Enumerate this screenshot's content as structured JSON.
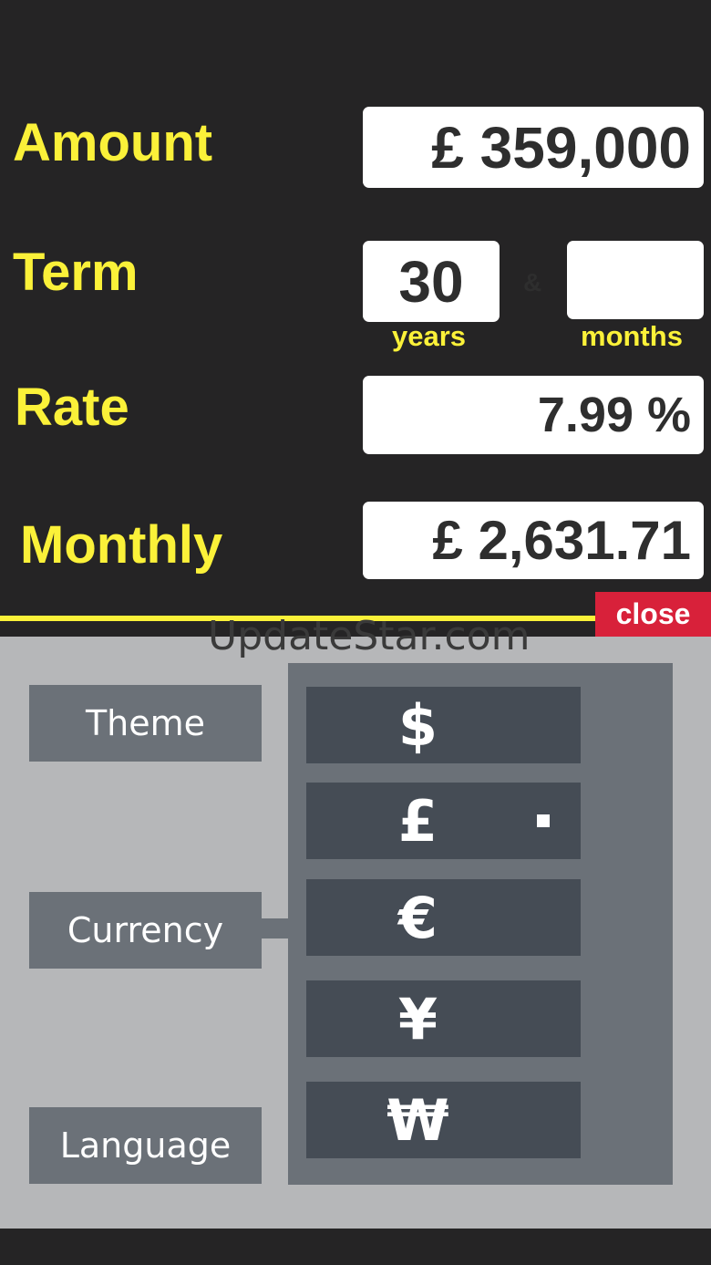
{
  "calculator": {
    "amount_label": "Amount",
    "amount_value": "£ 359,000",
    "term_label": "Term",
    "term_years": "30",
    "term_separator": "&",
    "term_months": "",
    "years_label": "years",
    "months_label": "months",
    "rate_label": "Rate",
    "rate_value": "7.99 %",
    "monthly_label": "Monthly",
    "monthly_value": "£ 2,631.71"
  },
  "close_label": "close",
  "watermark": "UpdateStar.com",
  "settings": {
    "menu": [
      {
        "label": "Theme"
      },
      {
        "label": "Currency"
      },
      {
        "label": "Language"
      }
    ],
    "currencies": [
      {
        "symbol": "$"
      },
      {
        "symbol": "£",
        "selected": true
      },
      {
        "symbol": "€"
      },
      {
        "symbol": "¥"
      },
      {
        "symbol": "₩"
      }
    ]
  },
  "colors": {
    "background": "#252425",
    "accent_yellow": "#fbf139",
    "close_red": "#d8213a",
    "panel_gray": "#b6b7b9",
    "button_gray": "#6b7178",
    "currency_button": "#454c55"
  }
}
